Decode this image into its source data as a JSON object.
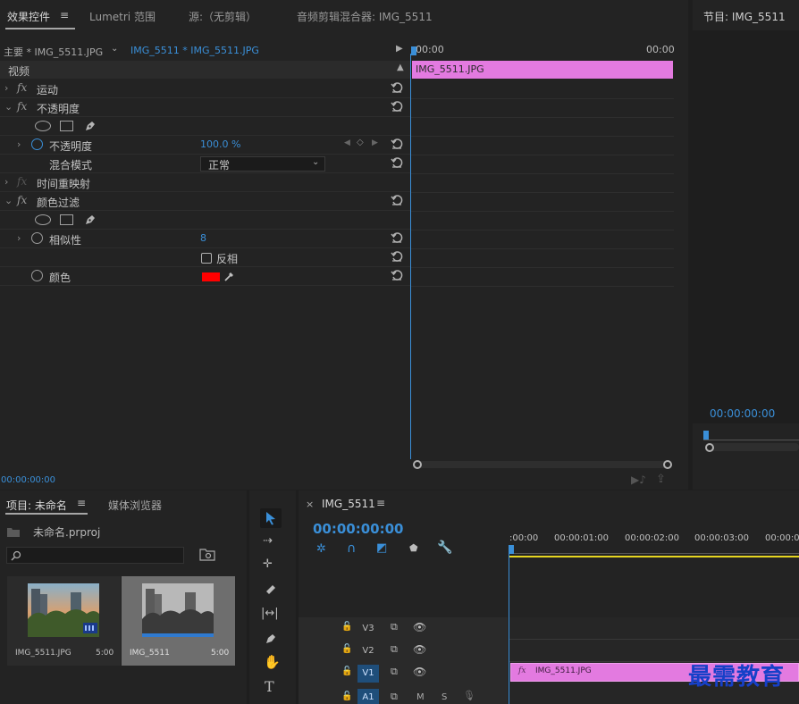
{
  "effect_controls": {
    "tabs": [
      "效果控件",
      "Lumetri 范围",
      "源:（无剪辑）",
      "音频剪辑混合器: IMG_5511"
    ],
    "master_label": "主要 * IMG_5511.JPG",
    "clip_label": "IMG_5511 * IMG_5511.JPG",
    "video_header": "视频",
    "rows": {
      "motion": "运动",
      "opacity": "不透明度",
      "opacity_param": "不透明度",
      "opacity_value": "100.0 %",
      "blend_mode_label": "混合模式",
      "blend_mode_value": "正常",
      "time_remap": "时间重映射",
      "color_filter": "颜色过滤",
      "similarity_label": "相似性",
      "similarity_value": "8",
      "invert_label": "反相",
      "color_label": "颜色"
    },
    "timeline_start": "00:00",
    "timeline_end": "00:00",
    "clip_name": "IMG_5511.JPG",
    "current_time": "00:00:00:00",
    "swatch_color": "#ff0000"
  },
  "program_monitor": {
    "title": "节目: IMG_5511",
    "timecode": "00:00:00:00"
  },
  "project": {
    "tabs": [
      "项目: 未命名",
      "媒体浏览器"
    ],
    "project_file": "未命名.prproj",
    "search_placeholder": "",
    "items": [
      {
        "name": "IMG_5511.JPG",
        "duration": "5:00"
      },
      {
        "name": "IMG_5511",
        "duration": "5:00"
      }
    ]
  },
  "sequence": {
    "tab_label": "IMG_5511",
    "timecode": "00:00:00:00",
    "ruler": [
      ":00:00",
      "00:00:01:00",
      "00:00:02:00",
      "00:00:03:00",
      "00:00:0"
    ],
    "tracks": [
      "V3",
      "V2",
      "V1",
      "A1"
    ],
    "track_controls": [
      "M",
      "S"
    ],
    "clip_name": "IMG_5511.JPG"
  },
  "watermark": "最需教育"
}
